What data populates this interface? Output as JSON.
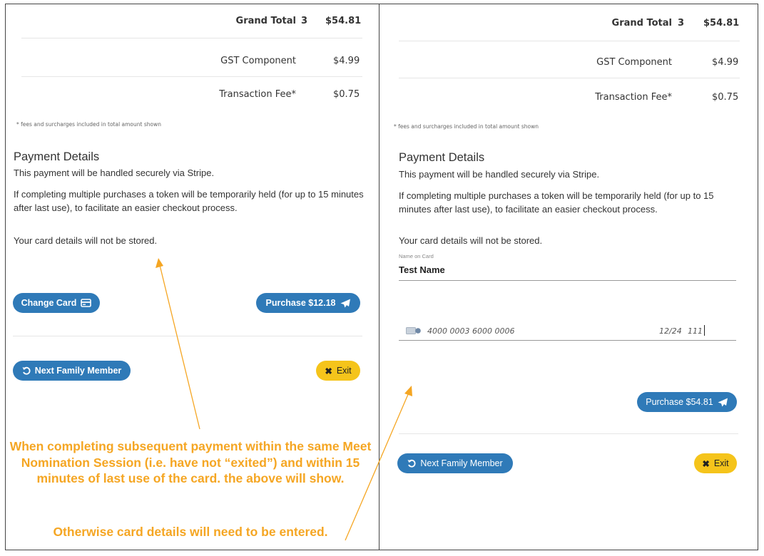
{
  "left": {
    "summary": {
      "grand_total_label": "Grand Total",
      "grand_total_count": "3",
      "grand_total_amount": "$54.81",
      "gst_label": "GST Component",
      "gst_amount": "$4.99",
      "fee_label": "Transaction Fee*",
      "fee_amount": "$0.75"
    },
    "fee_note": "* fees and surcharges included in total amount shown",
    "payment_title": "Payment Details",
    "payment_line1": "This payment will be handled securely via Stripe.",
    "payment_line2": "If completing multiple purchases a token will be temporarily held (for up to 15 minutes after last use), to facilitate an easier checkout process.",
    "payment_line3": "Your card details will not be stored.",
    "change_card_label": "Change Card",
    "purchase_label": "Purchase $12.18",
    "next_family_label": "Next Family Member",
    "exit_label": "Exit"
  },
  "right": {
    "summary": {
      "grand_total_label": "Grand Total",
      "grand_total_count": "3",
      "grand_total_amount": "$54.81",
      "gst_label": "GST Component",
      "gst_amount": "$4.99",
      "fee_label": "Transaction Fee*",
      "fee_amount": "$0.75"
    },
    "fee_note": "* fees and surcharges included in total amount shown",
    "payment_title": "Payment Details",
    "payment_line1": "This payment will be handled securely via Stripe.",
    "payment_line2": "If completing multiple purchases a token will be temporarily held (for up to 15 minutes after last use), to facilitate an easier checkout process.",
    "payment_line3": "Your card details will not be stored.",
    "name_on_card_label": "Name on Card",
    "name_on_card_value": "Test Name",
    "card_number": "4000 0003 6000 0006",
    "card_expiry": "12/24",
    "card_cvc": "111",
    "purchase_label": "Purchase $54.81",
    "next_family_label": "Next Family Member",
    "exit_label": "Exit"
  },
  "annotation": {
    "main": "When completing subsequent payment within the same Meet Nomination Session (i.e. have not “exited”) and within 15 minutes of last use of the card. the above will show.",
    "secondary": "Otherwise card details will need to be entered."
  },
  "colors": {
    "button_blue": "#2f7ab8",
    "button_yellow": "#f5c41b",
    "annotation_orange": "#f5a623"
  }
}
